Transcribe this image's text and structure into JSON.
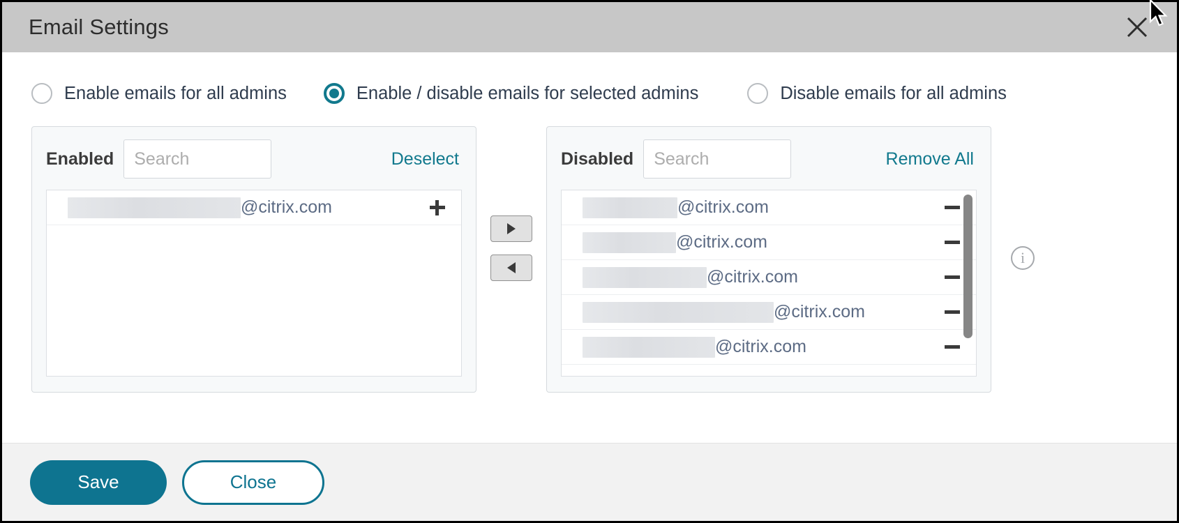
{
  "window": {
    "title": "Email Settings",
    "close_icon": "close-icon"
  },
  "colors": {
    "accent": "#0e7490",
    "radio_selected": "#11798d",
    "link": "#11798d",
    "titlebar_bg": "#c7c7c7",
    "footer_bg": "#f2f2f2",
    "panel_bg": "#f7f9fa",
    "email_text": "#5c6b84"
  },
  "radio_group": {
    "name": "email-scope",
    "options": [
      {
        "label": "Enable emails for all admins",
        "selected": false
      },
      {
        "label": "Enable / disable emails for selected admins",
        "selected": true
      },
      {
        "label": "Disable emails for all admins",
        "selected": false
      }
    ]
  },
  "enabled_panel": {
    "title": "Enabled",
    "search_value": "",
    "search_placeholder": "Search",
    "action_label": "Deselect",
    "row_action_icon": "plus-icon",
    "items": [
      {
        "redacted_width": 248,
        "domain": "@citrix.com"
      }
    ]
  },
  "disabled_panel": {
    "title": "Disabled",
    "search_value": "",
    "search_placeholder": "Search",
    "action_label": "Remove All",
    "row_action_icon": "minus-icon",
    "scrollbar": true,
    "items": [
      {
        "redacted_width": 136,
        "domain": "@citrix.com"
      },
      {
        "redacted_width": 134,
        "domain": "@citrix.com"
      },
      {
        "redacted_width": 178,
        "domain": "@citrix.com"
      },
      {
        "redacted_width": 274,
        "domain": "@citrix.com"
      },
      {
        "redacted_width": 190,
        "domain": "@citrix.com"
      }
    ]
  },
  "transfer_controls": {
    "move_right_icon": "triangle-right-icon",
    "move_left_icon": "triangle-left-icon"
  },
  "info": {
    "icon": "info-circle-icon",
    "glyph": "i"
  },
  "footer": {
    "save_label": "Save",
    "close_label": "Close"
  }
}
